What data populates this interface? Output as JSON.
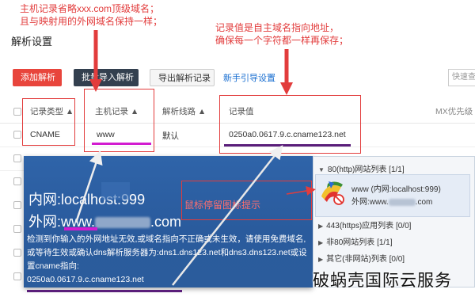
{
  "annotations": {
    "host_note_line1": "主机记录省略xxx.com顶级域名；",
    "host_note_line2": "且与映射用的外网域名保持一样；",
    "value_note_line1": "记录值是自主域名指向地址，",
    "value_note_line2": "确保每一个字符都一样再保存；",
    "hover_hint": "鼠标停留图标提示"
  },
  "page": {
    "title": "解析设置"
  },
  "toolbar": {
    "add_label": "添加解析",
    "batch_import_label": "批量导入解析",
    "export_label": "导出解析记录",
    "guide_label": "新手引导设置",
    "search_placeholder": "快速查"
  },
  "table": {
    "headers": [
      "记录类型",
      "主机记录",
      "解析线路",
      "记录值",
      "MX优先级"
    ],
    "rows": [
      {
        "type": "CNAME",
        "host": "www",
        "line": "默认",
        "value": "0250a0.0617.9.c.cname123.net"
      }
    ]
  },
  "tooltip": {
    "intranet_line": "内网:localhost:999",
    "extranet_prefix": "外网:www.",
    "extranet_suffix": ".com",
    "warning": "检测到你输入的外网地址无效,或域名指向不正确或未生效，请使用免费域名,或等待生效或确认dns解析服务器为:dns1.dns123.net和dns3.dns123.net或设置cname指向:",
    "cname_target": "0250a0.0617.9.c.cname123.net"
  },
  "panel": {
    "items": [
      {
        "label": "80(http)网站列表",
        "count": "[1/1]"
      },
      {
        "label": "443(https)应用列表",
        "count": "[0/0]"
      },
      {
        "label": "非80网站列表",
        "count": "[1/1]"
      },
      {
        "label": "其它(非网站)列表",
        "count": "[0/0]"
      }
    ],
    "entry_line1": "www  (内网:localhost:999)",
    "entry_line2_prefix": "外网:www.",
    "entry_line2_suffix": ".com"
  },
  "watermark": "破蜗壳国际云服务",
  "colors": {
    "annotation_red": "#e23c3c",
    "add_button": "#e8453c",
    "dark_button": "#33404f",
    "link_blue": "#1a6fd1",
    "tooltip_blue": "#2f64a9",
    "underline_magenta": "#d21bd0",
    "underline_purple": "#5a1e7a"
  }
}
